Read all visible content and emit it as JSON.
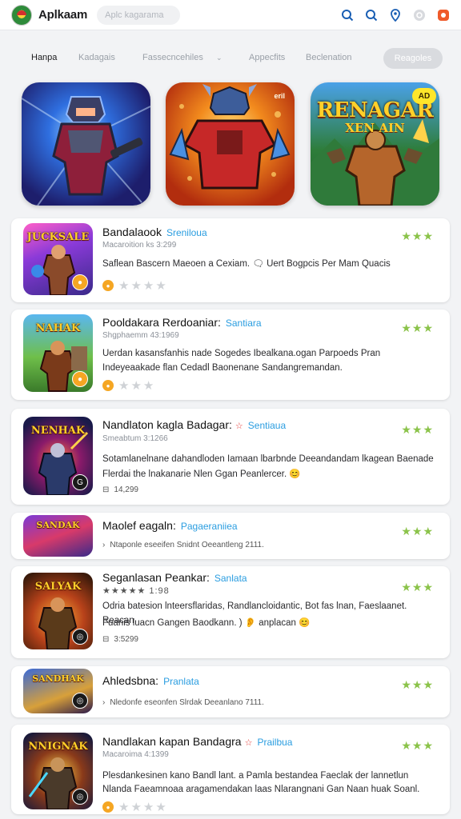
{
  "app": {
    "name": "Aplkaam",
    "search_placeholder": "Aplc kagarama"
  },
  "topbar_icons": [
    "search-icon",
    "search-icon",
    "location-pin-icon",
    "settings-icon",
    "app-icon"
  ],
  "tabs": [
    {
      "label": "Hanpa",
      "active": true
    },
    {
      "label": "Kadagais",
      "active": false
    },
    {
      "label": "Fassecncehiles",
      "active": false
    },
    {
      "label": "Appecfits",
      "active": false
    },
    {
      "label": "Beclenation",
      "active": false
    }
  ],
  "tab_button_label": "Reagoles",
  "hero": [
    {
      "title": "",
      "sub": "",
      "badge": ""
    },
    {
      "title": "",
      "sub": "",
      "badge": "eril"
    },
    {
      "title": "RENAGAR",
      "sub": "XEN AIN",
      "badge": "AD"
    }
  ],
  "cards": [
    {
      "thumb": "JUCKSALE",
      "title": "Bandalaook",
      "tag": "Sreniloua",
      "flag": "",
      "sub": "Macaroition ks 3:299",
      "desc1": "Saflean Bascern Maeoen a Cexiam. 🗨 Uert Bogpcis Per Mam Quacis",
      "desc2": "",
      "meta_text": "",
      "rating": "★★★"
    },
    {
      "thumb": "NAHAK",
      "title": "Pooldakara Rerdoaniar:",
      "tag": "Santiara",
      "flag": "",
      "sub": "Shgphaemm 43:1969",
      "desc1": "Uerdan kasansfanhis nade Sogedes Ibealkana.ogan Parpoeds Pran",
      "desc2": "Indeyeaakade flan Cedadl Baonenane Sandangremandan.",
      "meta_text": "",
      "rating": "★★★"
    },
    {
      "thumb": "NENHAK",
      "title": "Nandlaton kagla Badagar:",
      "tag": "Sentiaua",
      "flag": "☆",
      "sub": "Smeabtum 3:1266",
      "desc1": "Sotamlanelnane dahandloden Iamaan lbarbnde Deeandandam lkagean Baenade",
      "desc2": "Flerdai the lnakanarie Nlen Ggan Peanlercer. 😊",
      "meta_text": "14,299",
      "rating": "★★★"
    },
    {
      "thumb": "SANDAK",
      "title": "Maolef eagaln:",
      "tag": "Pagaeraniiea",
      "flag": "",
      "sub": "",
      "desc1": "",
      "desc2": "",
      "meta_text": "Ntaponle eseeifen Snidnt Oeeantleng 2111.",
      "rating": "★★★"
    },
    {
      "thumb": "SALYAK",
      "title": "Seganlasan Peankar:",
      "tag": "Sanlata",
      "flag": "",
      "sub": "★★★★★ 1:98",
      "desc1": "Odria batesion lnteersflaridas, Randlancloidantic, Bot fas lnan, Faeslaanet. Reacan",
      "desc2": "Fuanis luacn Gangen Baodkann. ) 👂 anplacan 😊",
      "meta_text": "3:5299",
      "rating": "★★★"
    },
    {
      "thumb": "SANDHAK",
      "title": "Ahledsbna:",
      "tag": "Pranlata",
      "flag": "",
      "sub": "",
      "desc1": "",
      "desc2": "",
      "meta_text": "Nledonfe eseonfen Slrdak Deeanlano 7111.",
      "rating": "★★★"
    },
    {
      "thumb": "NNIGNAK",
      "title": "Nandlakan kapan Bandagra",
      "tag": "Prailbua",
      "flag": "☆",
      "sub": "Macaroima 4:1399",
      "desc1": "Plesdankesinen kano Bandl lant. a Pamla bestandea Faeclak der lannetlun",
      "desc2": "Nlanda Faeamnoaa aragamendakan laas Nlarangnani Gan Naan huak Soanl.",
      "meta_text": "",
      "rating": "★★★"
    }
  ],
  "colors": {
    "accent": "#2a9de0",
    "star": "#8bc34a",
    "gold": "#f5b700"
  }
}
